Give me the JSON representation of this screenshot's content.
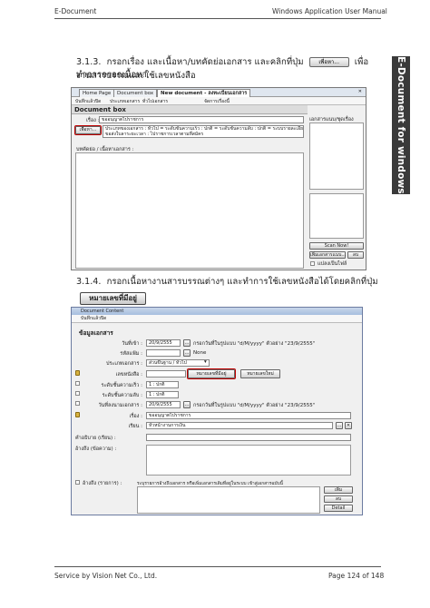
{
  "header": {
    "left": "E-Document",
    "right": "Windows Application User Manual"
  },
  "side_tab": "E-Document for windows",
  "section_313": {
    "prefix": "3.1.3.",
    "text_before": "กรอกเรื่อง และเนื้อหา/บทคัดย่อเอกสาร และคลิกที่ปุ่ม",
    "button": "เพื่อหา...",
    "text_after": "เพื่อทำการกรอกเนื้อหา",
    "line2": "งานสารบรรณและใช้เลขหนังสือ"
  },
  "shot1": {
    "tabs": [
      "Home Page",
      "Document box",
      "New document - ลงทะเบียนเอกสาร"
    ],
    "close": "✕",
    "toolbar": [
      "บันทึกแล้วปิด",
      "ประเภทเอกสาร",
      "ทั่วไปเอกสาร",
      "จัดการเรื่องนี้"
    ],
    "title": "Document box",
    "subject_label": "เรื่อง :",
    "subject_value": "ขออนุญาตไปราชการ",
    "find_btn": "เพื่อหา...",
    "desc_value": "ประเภทของเอกสาร : ทั่วไป = ระดับชั้นความเร็ว : ปกติ = ระดับชั้นความลับ : ปกติ = ระบบรายละเอียดเนื้อหาอื่นๆ",
    "desc_value2": "ขอส่งใบลาระยะเวลา : ไปราชการเวลาตามที่สมัคร",
    "abstract_label": "บทคัดย่อ / เนื้อหาเอกสาร :",
    "right_label": "เอกสารแนบ/ชุดเรื่อง",
    "scan_btn": "Scan Now!",
    "add_file_btn": "เพิ่มเอกสารแนบ...",
    "del_btn": "ลบ",
    "pdf_label": "แปลงเป็นไฟล์"
  },
  "section_314": {
    "prefix": "3.1.4.",
    "text": "กรอกเนื้อหางานสารบรรณต่างๆ และทำการใช้เลขหนังสือได้โดยคลิกที่ปุ่ม"
  },
  "reserve_button": "หมายเลขที่มีอยู่",
  "shot2": {
    "title": "Document Content",
    "toolbar": "บันทึกแล้วปิด",
    "section": "ข้อมูลเอกสาร",
    "rows": [
      {
        "label": "วันที่เข้า :",
        "value": "20/9/2555",
        "hint": "กรอกวันที่ในรูปแบบ \"d/M/yyyy\" ตัวอย่าง \"23/9/2555\""
      },
      {
        "label": "รหัสแฟ้ม :",
        "value": "None"
      },
      {
        "label": "ประเภทเอกสาร :",
        "value": "ส่วนขึ้นฐาน / ทั่วไป"
      },
      {
        "label": "เลขหนังสือ :",
        "value": ""
      },
      {
        "label": "ระดับชั้นความเร็ว :",
        "value": "1 : ปกติ"
      },
      {
        "label": "ระดับชั้นความลับ :",
        "value": "1 : ปกติ"
      },
      {
        "label": "วันที่ลงนามเอกสาร :",
        "value": "20/9/2555",
        "hint": "กรอกวันที่ในรูปแบบ \"d/M/yyyy\" ตัวอย่าง \"23/9/2555\""
      },
      {
        "label": "เรื่อง :",
        "value": "ขออนุญาตไปราชการ"
      },
      {
        "label": "เรียน :",
        "value": "หัวหน้างานการเงิน"
      },
      {
        "label": "คำอธิบาย (เรียน) :",
        "value": ""
      },
      {
        "label": "อ้างถึง (ข้อความ) :",
        "value": ""
      },
      {
        "label": "อ้างถึง (รายการ) :",
        "value": "ระบุรายการอ้างถึงเอกสาร หรือเพิ่มเอกสารเดิมที่อยู่ในระบบ เข้าสู่เอกสารฉบับนี้"
      }
    ],
    "reserve_btn": "หมายเลขที่มีอยู่",
    "new_btn": "หมายเลขใหม่",
    "ellipsis": "...",
    "add_btn": "เพิ่ม",
    "delete_btn": "ลบ",
    "detail_btn": "Detail"
  },
  "footer": {
    "left": "Service by Vision Net Co., Ltd.",
    "page_prefix": "Page",
    "page": "124",
    "of_word": "of",
    "total": "148"
  }
}
